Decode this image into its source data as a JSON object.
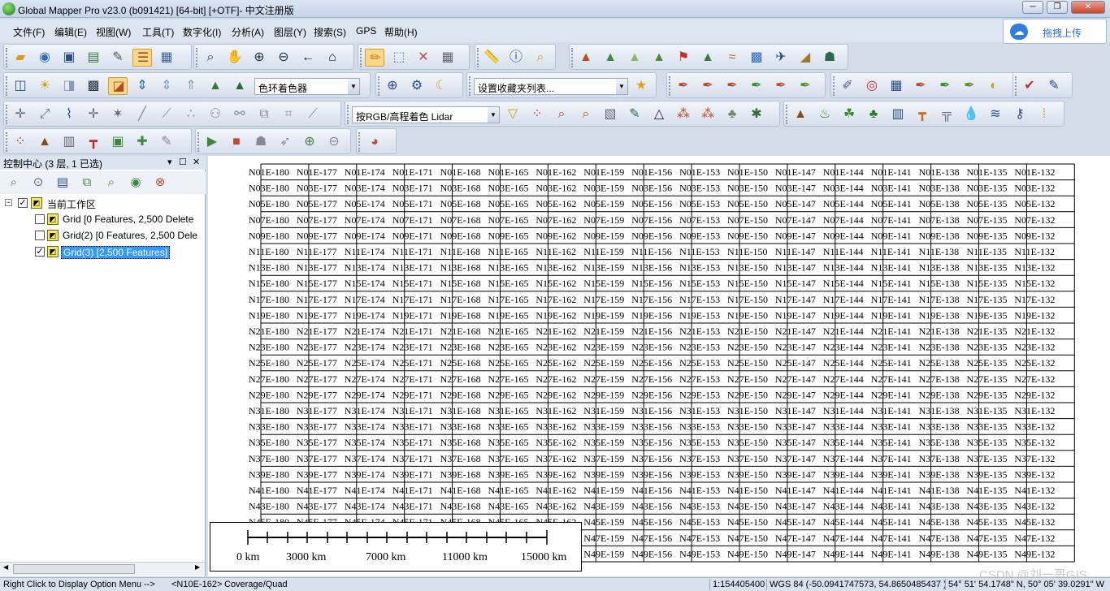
{
  "window": {
    "title": "Global Mapper Pro v23.0 (b091421) [64-bit] [+OTF]- 中文注册版",
    "minimize_glyph": "─",
    "maximize_glyph": "❐",
    "close_glyph": "✕"
  },
  "menu": [
    "文件(F)",
    "编辑(E)",
    "视图(W)",
    "工具(T)",
    "数字化(I)",
    "分析(A)",
    "图层(Y)",
    "搜索(S)",
    "GPS",
    "帮助(H)"
  ],
  "upload_button": {
    "label": "拖拽上传",
    "icon": "cloud-upload-icon"
  },
  "toolbars": {
    "shader_select": "色环着色器",
    "favorites_select": "设置收藏夹列表...",
    "lidar_select": "按RGB/高程着色 Lidar"
  },
  "panel": {
    "title": "控制中心 (3 层, 1 已选)",
    "pin_glyph": "▾",
    "float_glyph": "☐",
    "close_glyph": "✕",
    "tree": {
      "root": "当前工作区",
      "layers": [
        {
          "label": "Grid [0 Features, 2,500 Delete",
          "checked": false,
          "selected": false
        },
        {
          "label": "Grid(2) [0 Features, 2,500 Dele",
          "checked": false,
          "selected": false
        },
        {
          "label": "Grid(3) [2,500 Features]",
          "checked": true,
          "selected": true
        }
      ]
    }
  },
  "map": {
    "grid_rows": [
      "N01",
      "N03",
      "N05",
      "N07",
      "N09",
      "N11",
      "N13",
      "N15",
      "N17",
      "N19",
      "N21",
      "N23",
      "N25",
      "N27",
      "N29",
      "N31",
      "N33",
      "N35",
      "N37",
      "N39",
      "N41",
      "N43",
      "N45",
      "N47",
      "N49"
    ],
    "grid_cols": [
      "E-180",
      "E-177",
      "E-174",
      "E-171",
      "E-168",
      "E-165",
      "E-162",
      "E-159",
      "E-156",
      "E-153",
      "E-150",
      "E-147",
      "E-144",
      "E-141",
      "E-138",
      "E-135",
      "E-132"
    ]
  },
  "scalebar": {
    "labels": [
      "0 km",
      "3000 km",
      "7000 km",
      "11000 km",
      "15000 km"
    ]
  },
  "watermark": "CSDN @刘一哥GIS",
  "status": {
    "hint": "Right Click to Display Option Menu -->",
    "feature": "<N10E-162>",
    "coverage": "Coverage/Quad",
    "scale": "1:154405400",
    "coords": "WGS 84 (-50.0941747573, 54.8650485437 )",
    "dms": "54° 51' 54.1748\" N, 50° 05' 39.0291\" W"
  }
}
